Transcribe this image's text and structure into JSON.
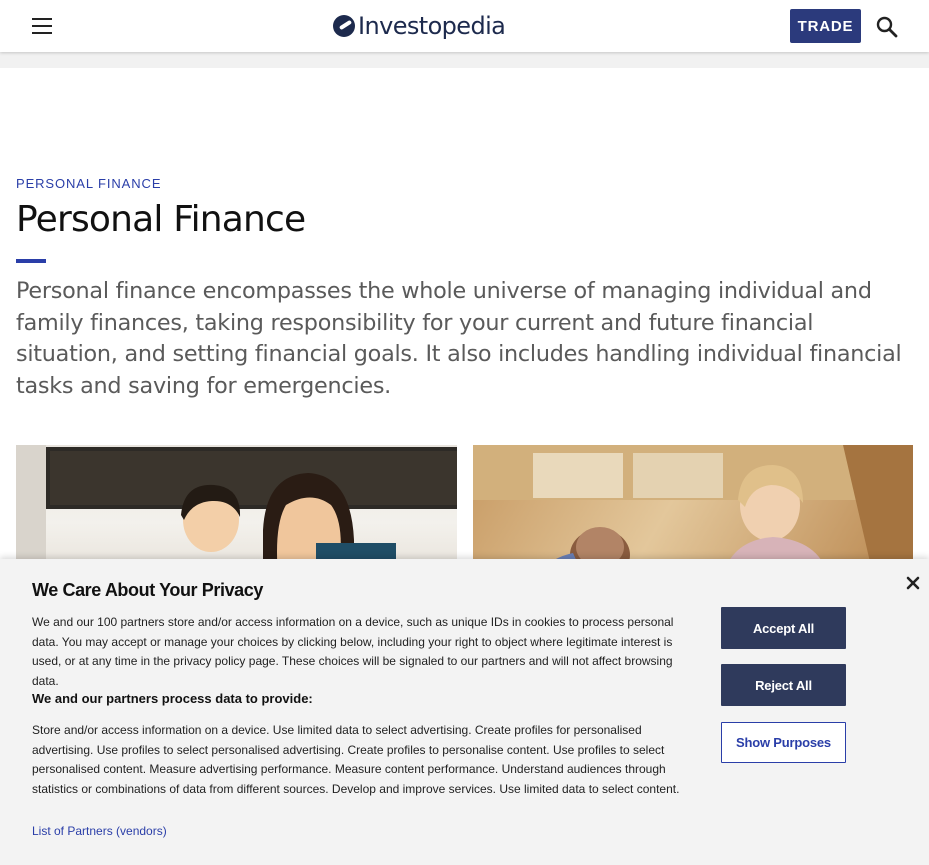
{
  "header": {
    "logo_text": "Investopedia",
    "trade_label": "TRADE"
  },
  "article": {
    "eyebrow": "PERSONAL FINANCE",
    "title": "Personal Finance",
    "intro": "Personal finance encompasses the whole universe of managing individual and family finances, taking responsibility for your current and future financial situation, and setting financial goals. It also includes handling individual financial tasks and saving for emergencies."
  },
  "consent": {
    "title": "We Care About Your Privacy",
    "body": "We and our 100 partners store and/or access information on a device, such as unique IDs in cookies to process personal data. You may accept or manage your choices by clicking below, including your right to object where legitimate interest is used, or at any time in the privacy policy page. These choices will be signaled to our partners and will not affect browsing data.",
    "subheading": "We and our partners process data to provide:",
    "purposes_text": "Store and/or access information on a device. Use limited data to select advertising. Create profiles for personalised advertising. Use profiles to select personalised advertising. Create profiles to personalise content. Use profiles to select personalised content. Measure advertising performance. Measure content performance. Understand audiences through statistics or combinations of data from different sources. Develop and improve services. Use limited data to select content.",
    "partners_link": "List of Partners (vendors)",
    "accept_label": "Accept All",
    "reject_label": "Reject All",
    "show_purposes_label": "Show Purposes"
  },
  "icons": {
    "menu": "hamburger-icon",
    "search": "search-icon",
    "close": "close-icon",
    "logo": "investopedia-logo-icon"
  },
  "colors": {
    "brand_navy": "#1d2a4d",
    "trade_button": "#2b3a7c",
    "accent_blue": "#2a3ea8",
    "consent_button": "#2f3a5c"
  }
}
